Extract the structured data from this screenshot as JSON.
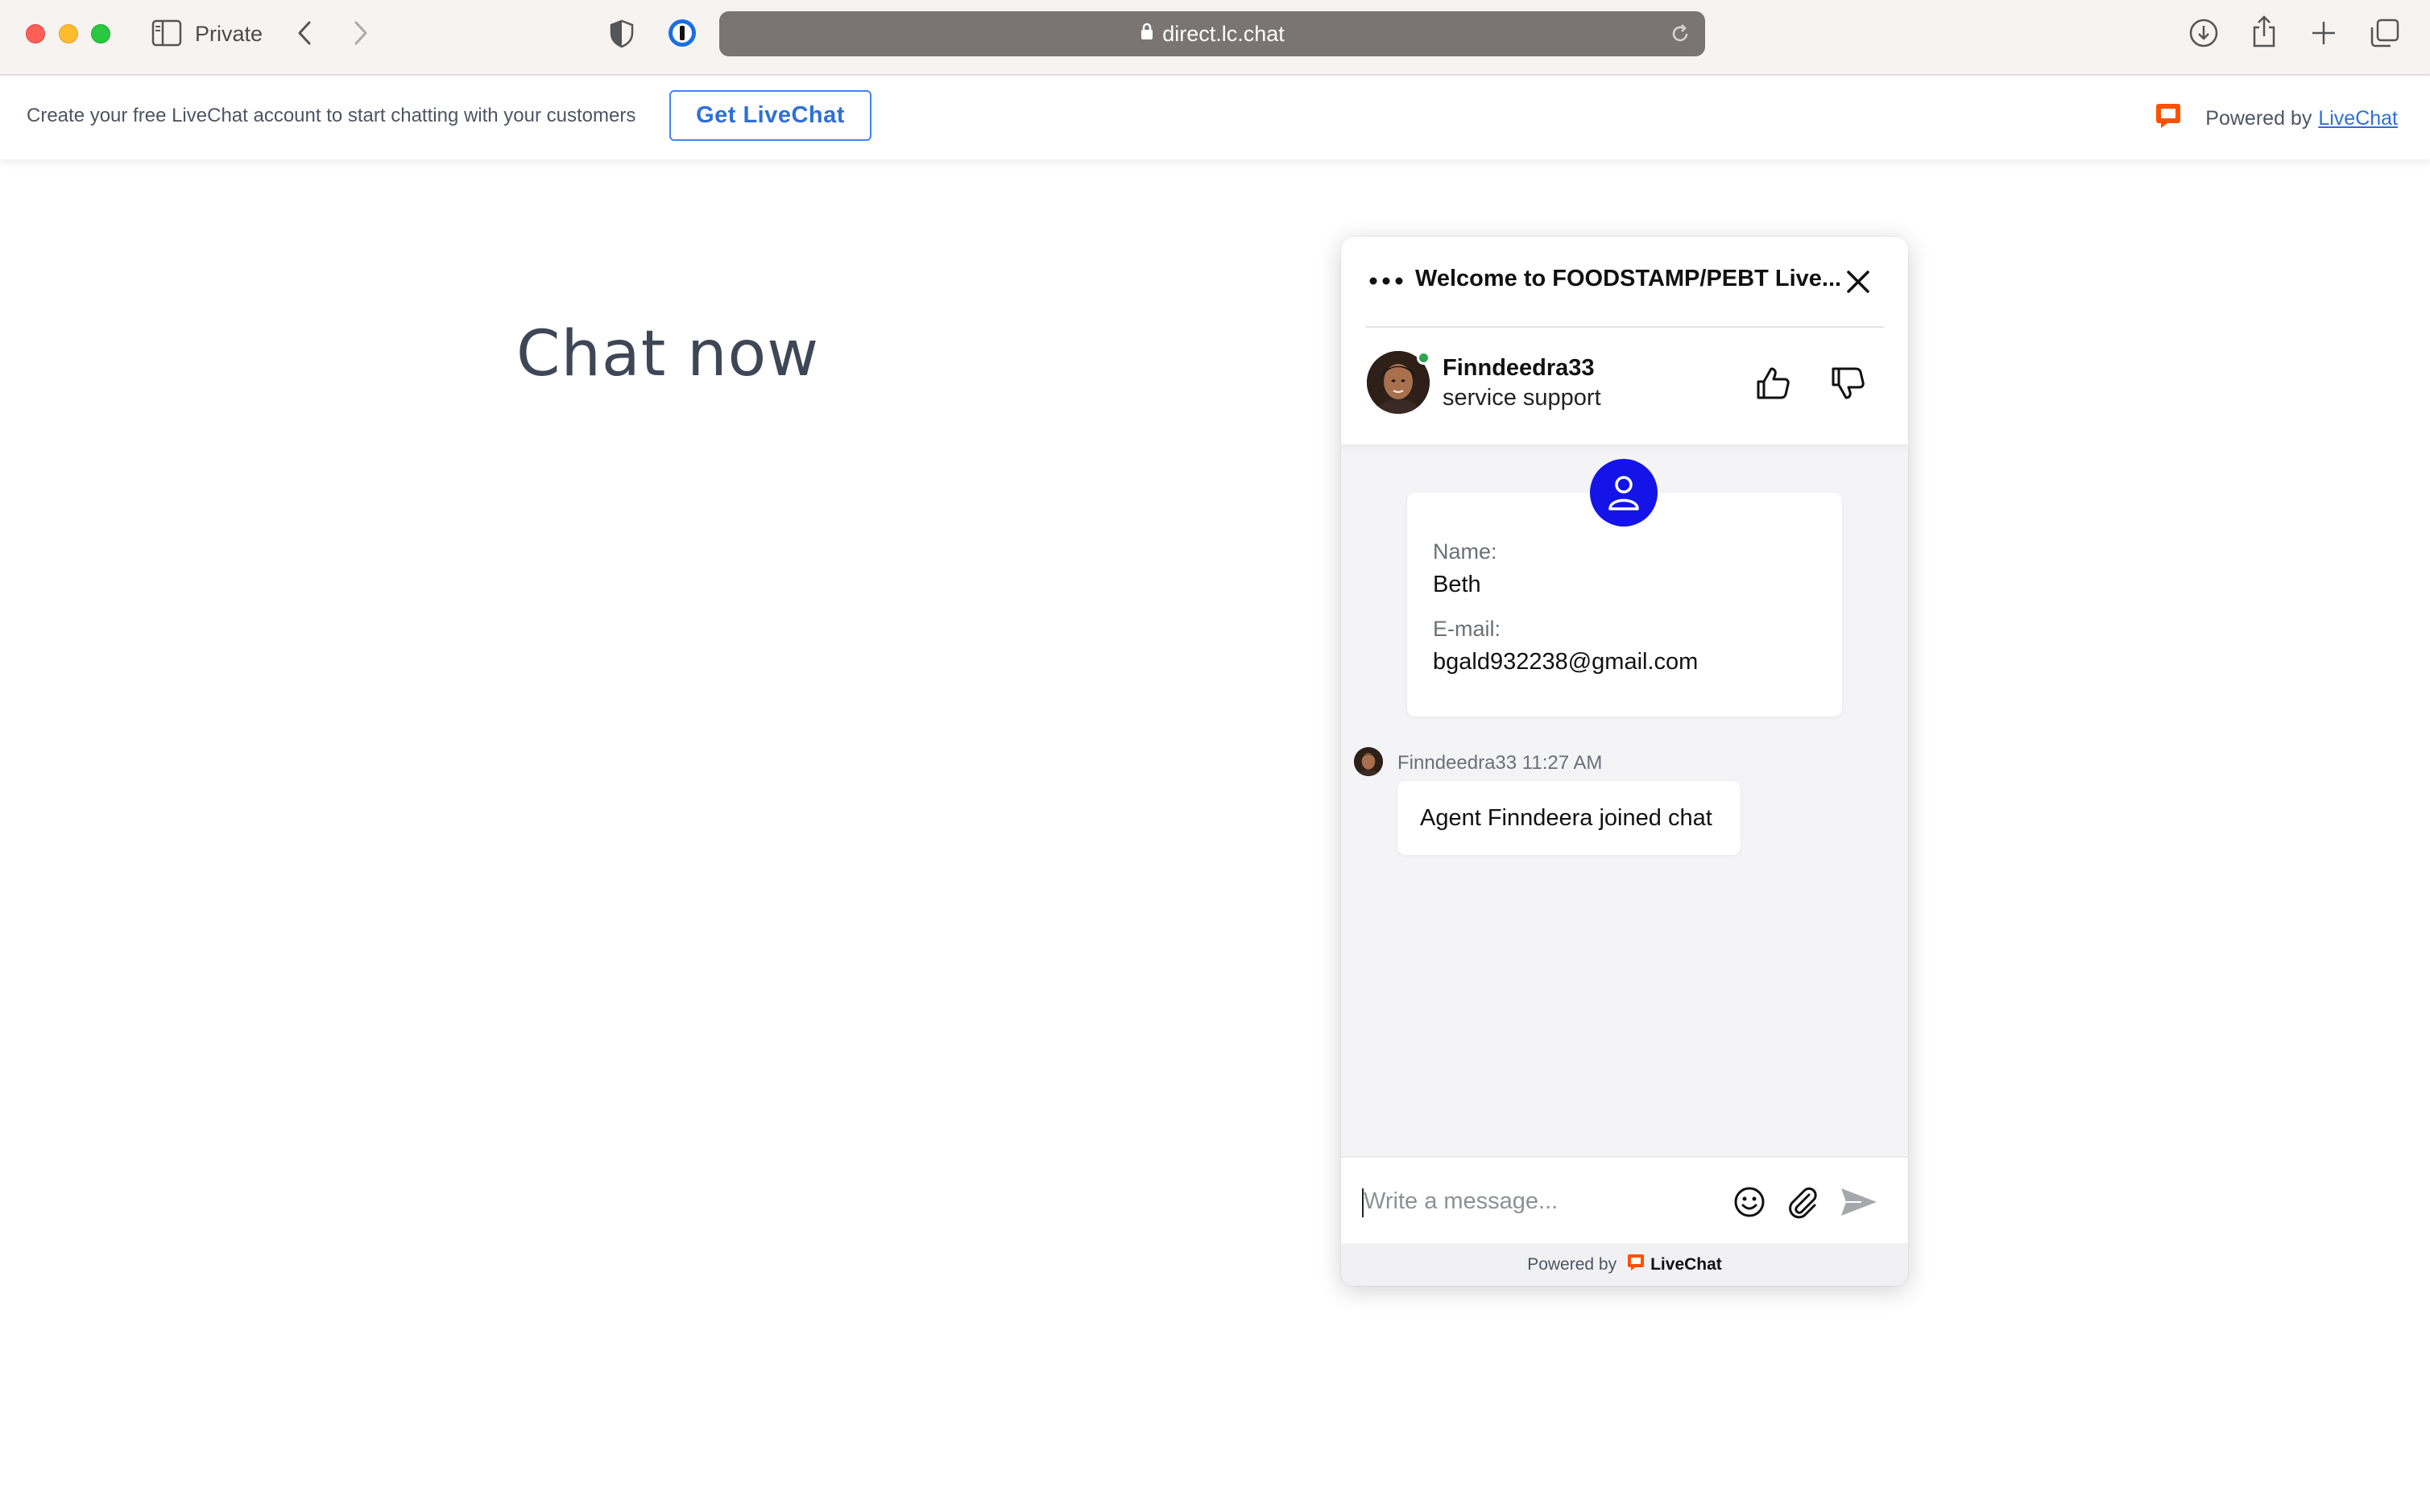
{
  "browser": {
    "mode_label": "Private",
    "url": "direct.lc.chat"
  },
  "promo": {
    "text": "Create your free LiveChat account to start chatting with your customers",
    "button_label": "Get LiveChat",
    "powered_by_prefix": "Powered by",
    "powered_by_link": "LiveChat"
  },
  "page": {
    "heading": "Chat now"
  },
  "chat": {
    "title": "Welcome to FOODSTAMP/PEBT Live...",
    "agent": {
      "name": "Finndeedra33",
      "role": "service support",
      "status": "online"
    },
    "prechat_form": {
      "fields": [
        {
          "label": "Name:",
          "value": "Beth"
        },
        {
          "label": "E-mail:",
          "value": "bgald932238@gmail.com"
        }
      ]
    },
    "messages": [
      {
        "author": "Finndeedra33",
        "time": "11:27 AM",
        "meta": "Finndeedra33 11:27 AM",
        "text": "Agent Finndeera joined chat"
      }
    ],
    "input_placeholder": "Write a message...",
    "footer_prefix": "Powered by",
    "footer_brand": "LiveChat"
  },
  "colors": {
    "brand_orange": "#ff5100",
    "link_blue": "#2f6fd6",
    "form_icon_blue": "#1414e8",
    "online_green": "#2ea44f"
  },
  "icons": [
    "sidebar-icon",
    "back-icon",
    "forward-icon",
    "shield-icon",
    "password-manager-icon",
    "lock-icon",
    "reload-icon",
    "download-icon",
    "share-icon",
    "new-tab-icon",
    "tabs-overview-icon",
    "livechat-logo-icon",
    "more-options-icon",
    "close-icon",
    "thumbs-up-icon",
    "thumbs-down-icon",
    "user-icon",
    "emoji-icon",
    "attachment-icon",
    "send-icon"
  ]
}
